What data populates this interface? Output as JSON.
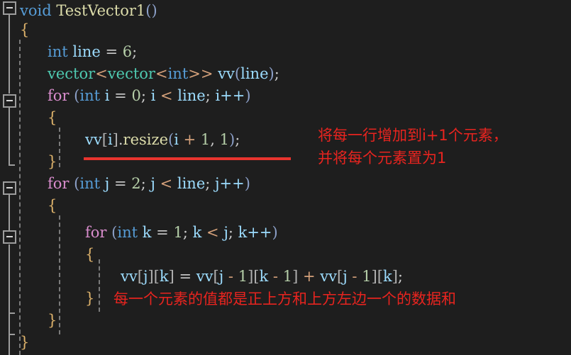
{
  "editor": {
    "background": "#1e1e1e",
    "title": "code-editor"
  },
  "code": {
    "lines": [
      {
        "id": "l1",
        "indent": 0,
        "text": "void TestVector1()"
      },
      {
        "id": "l2",
        "indent": 1,
        "text": "{"
      },
      {
        "id": "l3",
        "indent": 2,
        "text": "int line = 6;"
      },
      {
        "id": "l4",
        "indent": 2,
        "text": "vector<vector<int>> vv(line);"
      },
      {
        "id": "l5",
        "indent": 2,
        "text": "for (int i = 0; i < line; i++)"
      },
      {
        "id": "l6",
        "indent": 2,
        "text": "{"
      },
      {
        "id": "l7",
        "indent": 3,
        "text": "vv[i].resize(i + 1, 1);"
      },
      {
        "id": "l8",
        "indent": 2,
        "text": "}"
      },
      {
        "id": "l9",
        "indent": 2,
        "text": "for (int j = 2; j < line; j++)"
      },
      {
        "id": "l10",
        "indent": 2,
        "text": "{"
      },
      {
        "id": "l11",
        "indent": 3,
        "text": "for (int k = 1; k < j; k++)"
      },
      {
        "id": "l12",
        "indent": 3,
        "text": "{"
      },
      {
        "id": "l13",
        "indent": 4,
        "text": "vv[j][k] = vv[j - 1][k - 1] + vv[j - 1][k];"
      },
      {
        "id": "l14",
        "indent": 3,
        "text": "}"
      },
      {
        "id": "l15",
        "indent": 2,
        "text": "}"
      },
      {
        "id": "l16",
        "indent": 1,
        "text": "}"
      }
    ]
  },
  "annotations": {
    "resize_note_line1": "将每一行增加到i+1个元素，",
    "resize_note_line2": "并将每个元素置为1",
    "sum_note": "每一个元素的值都是正上方和上方左边一个的数据和",
    "color": "#e8241f"
  },
  "gutter": {
    "fold_markers": [
      {
        "name": "fold-marker-function",
        "state": "expanded"
      },
      {
        "name": "fold-marker-for-i",
        "state": "expanded"
      },
      {
        "name": "fold-marker-for-j",
        "state": "expanded"
      },
      {
        "name": "fold-marker-for-k",
        "state": "expanded"
      }
    ]
  }
}
